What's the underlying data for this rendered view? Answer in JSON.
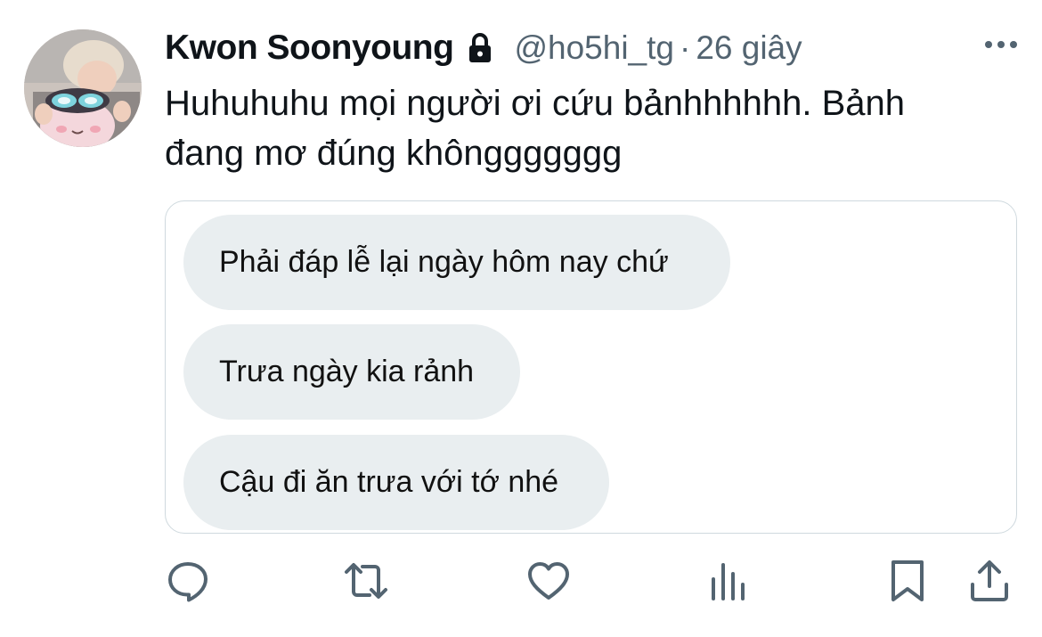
{
  "tweet": {
    "author": {
      "display_name": "Kwon Soonyoung",
      "handle": "@ho5hi_tg",
      "protected_icon": "lock-icon"
    },
    "separator": "·",
    "time": "26 giây",
    "text": "Huhuhuhu mọi người ơi cứu bảnhhhhhh. Bảnh\nđang mơ đúng khônggggggg",
    "media": {
      "messages": [
        "Phải đáp lễ lại ngày hôm nay chứ",
        "Trưa ngày kia rảnh",
        "Cậu đi ăn trưa với tớ nhé"
      ]
    },
    "actions": [
      "reply-icon",
      "retweet-icon",
      "like-icon",
      "views-icon",
      "bookmark-icon",
      "share-icon"
    ]
  },
  "colors": {
    "text_primary": "#0f1419",
    "text_secondary": "#536471",
    "bubble_bg": "#e9eef0",
    "border": "#cfd9de"
  }
}
